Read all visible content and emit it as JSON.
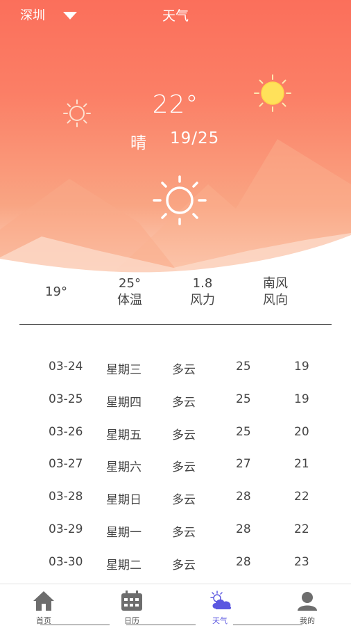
{
  "header": {
    "city": "深圳",
    "title": "天气"
  },
  "current": {
    "temperature": "22°",
    "condition": "晴",
    "range": "19/25"
  },
  "stats": [
    {
      "value": "19°",
      "label": ""
    },
    {
      "value": "25°",
      "label": "体温"
    },
    {
      "value": "1.8",
      "label": "风力"
    },
    {
      "value": "南风",
      "label": "风向"
    }
  ],
  "forecast": [
    {
      "date": "03-24",
      "weekday": "星期三",
      "condition": "多云",
      "high": "25",
      "low": "19"
    },
    {
      "date": "03-25",
      "weekday": "星期四",
      "condition": "多云",
      "high": "25",
      "low": "19"
    },
    {
      "date": "03-26",
      "weekday": "星期五",
      "condition": "多云",
      "high": "25",
      "low": "20"
    },
    {
      "date": "03-27",
      "weekday": "星期六",
      "condition": "多云",
      "high": "27",
      "low": "21"
    },
    {
      "date": "03-28",
      "weekday": "星期日",
      "condition": "多云",
      "high": "28",
      "low": "22"
    },
    {
      "date": "03-29",
      "weekday": "星期一",
      "condition": "多云",
      "high": "28",
      "low": "22"
    },
    {
      "date": "03-30",
      "weekday": "星期二",
      "condition": "多云",
      "high": "28",
      "low": "23"
    }
  ],
  "tabbar": {
    "items": [
      {
        "label": "首页",
        "icon": "home-icon"
      },
      {
        "label": "日历",
        "icon": "calendar-icon"
      },
      {
        "label": "天气",
        "icon": "weather-icon",
        "active": true
      },
      {
        "label": "我的",
        "icon": "profile-icon"
      }
    ]
  },
  "colors": {
    "hero_top": "#fb6f5b",
    "hero_bottom": "#fcd3be",
    "active_tab": "#5b57e0",
    "sun_yellow": "#ffe15a"
  }
}
